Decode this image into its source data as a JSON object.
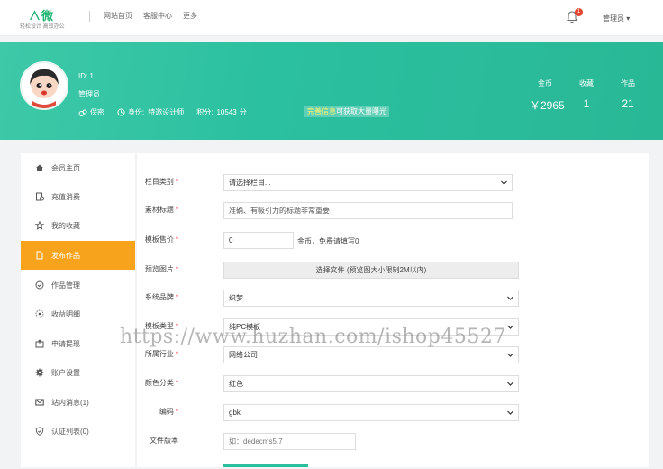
{
  "topbar": {
    "logo_main": "∧微",
    "logo_sub": "轻松设计 高效办公",
    "nav": [
      "网站首页",
      "客服中心",
      "更多"
    ],
    "notify_count": "1",
    "user_menu": "管理员"
  },
  "profile": {
    "id_text": "ID: 1",
    "role": "管理员",
    "stats": {
      "confidential": "保密",
      "identity_label": "身份:",
      "identity_value": "特邀设计师",
      "points_label": "积分:",
      "points_value": "10543",
      "points_unit": "分"
    },
    "promo_highlight": "完善信息",
    "promo_rest": "可获取大量曝光"
  },
  "summary": [
    {
      "label": "金币",
      "value": "￥2965"
    },
    {
      "label": "收藏",
      "value": "1"
    },
    {
      "label": "作品",
      "value": "21"
    }
  ],
  "sidebar": {
    "items": [
      {
        "label": "会员主页",
        "icon": "home-icon"
      },
      {
        "label": "充值消费",
        "icon": "recharge-icon"
      },
      {
        "label": "我的收藏",
        "icon": "star-icon"
      },
      {
        "label": "发布作品",
        "icon": "publish-icon",
        "active": true
      },
      {
        "label": "作品管理",
        "icon": "check-circle-icon"
      },
      {
        "label": "收益明细",
        "icon": "income-icon"
      },
      {
        "label": "申请提现",
        "icon": "withdraw-icon"
      },
      {
        "label": "账户设置",
        "icon": "gear-icon"
      },
      {
        "label": "站内消息(1)",
        "icon": "mail-icon"
      },
      {
        "label": "认证列表(0)",
        "icon": "shield-icon"
      }
    ]
  },
  "form": {
    "category": {
      "label": "栏目类别",
      "value": "请选择栏目..."
    },
    "title": {
      "label": "素材标题",
      "placeholder": "准确、有吸引力的标题非常重要"
    },
    "price": {
      "label": "模板售价",
      "value": "0",
      "suffix": "金币，免费请填写0"
    },
    "preview": {
      "label": "预览图片",
      "button": "选择文件 (预览图大小限制2M以内)"
    },
    "brand": {
      "label": "系统品牌",
      "value": "织梦"
    },
    "type": {
      "label": "模板类型",
      "value": "纯PC模板"
    },
    "industry": {
      "label": "所属行业",
      "value": "网络公司"
    },
    "color": {
      "label": "颜色分类",
      "value": "红色"
    },
    "encoding": {
      "label": "编码",
      "value": "gbk"
    },
    "version": {
      "label": "文件版本",
      "placeholder": "如：dedecms5.7"
    }
  },
  "watermark": "https://www.huzhan.com/ishop45527"
}
